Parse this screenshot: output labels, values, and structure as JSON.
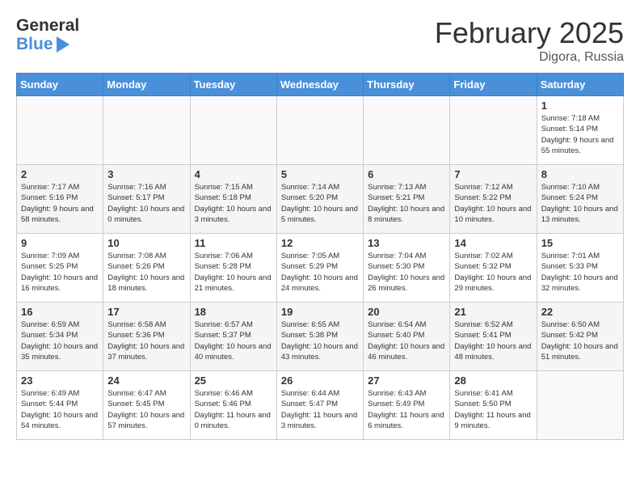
{
  "header": {
    "logo_general": "General",
    "logo_blue": "Blue",
    "title": "February 2025",
    "location": "Digora, Russia"
  },
  "days_of_week": [
    "Sunday",
    "Monday",
    "Tuesday",
    "Wednesday",
    "Thursday",
    "Friday",
    "Saturday"
  ],
  "weeks": [
    [
      {
        "day": "",
        "info": ""
      },
      {
        "day": "",
        "info": ""
      },
      {
        "day": "",
        "info": ""
      },
      {
        "day": "",
        "info": ""
      },
      {
        "day": "",
        "info": ""
      },
      {
        "day": "",
        "info": ""
      },
      {
        "day": "1",
        "info": "Sunrise: 7:18 AM\nSunset: 5:14 PM\nDaylight: 9 hours and 55 minutes."
      }
    ],
    [
      {
        "day": "2",
        "info": "Sunrise: 7:17 AM\nSunset: 5:16 PM\nDaylight: 9 hours and 58 minutes."
      },
      {
        "day": "3",
        "info": "Sunrise: 7:16 AM\nSunset: 5:17 PM\nDaylight: 10 hours and 0 minutes."
      },
      {
        "day": "4",
        "info": "Sunrise: 7:15 AM\nSunset: 5:18 PM\nDaylight: 10 hours and 3 minutes."
      },
      {
        "day": "5",
        "info": "Sunrise: 7:14 AM\nSunset: 5:20 PM\nDaylight: 10 hours and 5 minutes."
      },
      {
        "day": "6",
        "info": "Sunrise: 7:13 AM\nSunset: 5:21 PM\nDaylight: 10 hours and 8 minutes."
      },
      {
        "day": "7",
        "info": "Sunrise: 7:12 AM\nSunset: 5:22 PM\nDaylight: 10 hours and 10 minutes."
      },
      {
        "day": "8",
        "info": "Sunrise: 7:10 AM\nSunset: 5:24 PM\nDaylight: 10 hours and 13 minutes."
      }
    ],
    [
      {
        "day": "9",
        "info": "Sunrise: 7:09 AM\nSunset: 5:25 PM\nDaylight: 10 hours and 16 minutes."
      },
      {
        "day": "10",
        "info": "Sunrise: 7:08 AM\nSunset: 5:26 PM\nDaylight: 10 hours and 18 minutes."
      },
      {
        "day": "11",
        "info": "Sunrise: 7:06 AM\nSunset: 5:28 PM\nDaylight: 10 hours and 21 minutes."
      },
      {
        "day": "12",
        "info": "Sunrise: 7:05 AM\nSunset: 5:29 PM\nDaylight: 10 hours and 24 minutes."
      },
      {
        "day": "13",
        "info": "Sunrise: 7:04 AM\nSunset: 5:30 PM\nDaylight: 10 hours and 26 minutes."
      },
      {
        "day": "14",
        "info": "Sunrise: 7:02 AM\nSunset: 5:32 PM\nDaylight: 10 hours and 29 minutes."
      },
      {
        "day": "15",
        "info": "Sunrise: 7:01 AM\nSunset: 5:33 PM\nDaylight: 10 hours and 32 minutes."
      }
    ],
    [
      {
        "day": "16",
        "info": "Sunrise: 6:59 AM\nSunset: 5:34 PM\nDaylight: 10 hours and 35 minutes."
      },
      {
        "day": "17",
        "info": "Sunrise: 6:58 AM\nSunset: 5:36 PM\nDaylight: 10 hours and 37 minutes."
      },
      {
        "day": "18",
        "info": "Sunrise: 6:57 AM\nSunset: 5:37 PM\nDaylight: 10 hours and 40 minutes."
      },
      {
        "day": "19",
        "info": "Sunrise: 6:55 AM\nSunset: 5:38 PM\nDaylight: 10 hours and 43 minutes."
      },
      {
        "day": "20",
        "info": "Sunrise: 6:54 AM\nSunset: 5:40 PM\nDaylight: 10 hours and 46 minutes."
      },
      {
        "day": "21",
        "info": "Sunrise: 6:52 AM\nSunset: 5:41 PM\nDaylight: 10 hours and 48 minutes."
      },
      {
        "day": "22",
        "info": "Sunrise: 6:50 AM\nSunset: 5:42 PM\nDaylight: 10 hours and 51 minutes."
      }
    ],
    [
      {
        "day": "23",
        "info": "Sunrise: 6:49 AM\nSunset: 5:44 PM\nDaylight: 10 hours and 54 minutes."
      },
      {
        "day": "24",
        "info": "Sunrise: 6:47 AM\nSunset: 5:45 PM\nDaylight: 10 hours and 57 minutes."
      },
      {
        "day": "25",
        "info": "Sunrise: 6:46 AM\nSunset: 5:46 PM\nDaylight: 11 hours and 0 minutes."
      },
      {
        "day": "26",
        "info": "Sunrise: 6:44 AM\nSunset: 5:47 PM\nDaylight: 11 hours and 3 minutes."
      },
      {
        "day": "27",
        "info": "Sunrise: 6:43 AM\nSunset: 5:49 PM\nDaylight: 11 hours and 6 minutes."
      },
      {
        "day": "28",
        "info": "Sunrise: 6:41 AM\nSunset: 5:50 PM\nDaylight: 11 hours and 9 minutes."
      },
      {
        "day": "",
        "info": ""
      }
    ]
  ]
}
